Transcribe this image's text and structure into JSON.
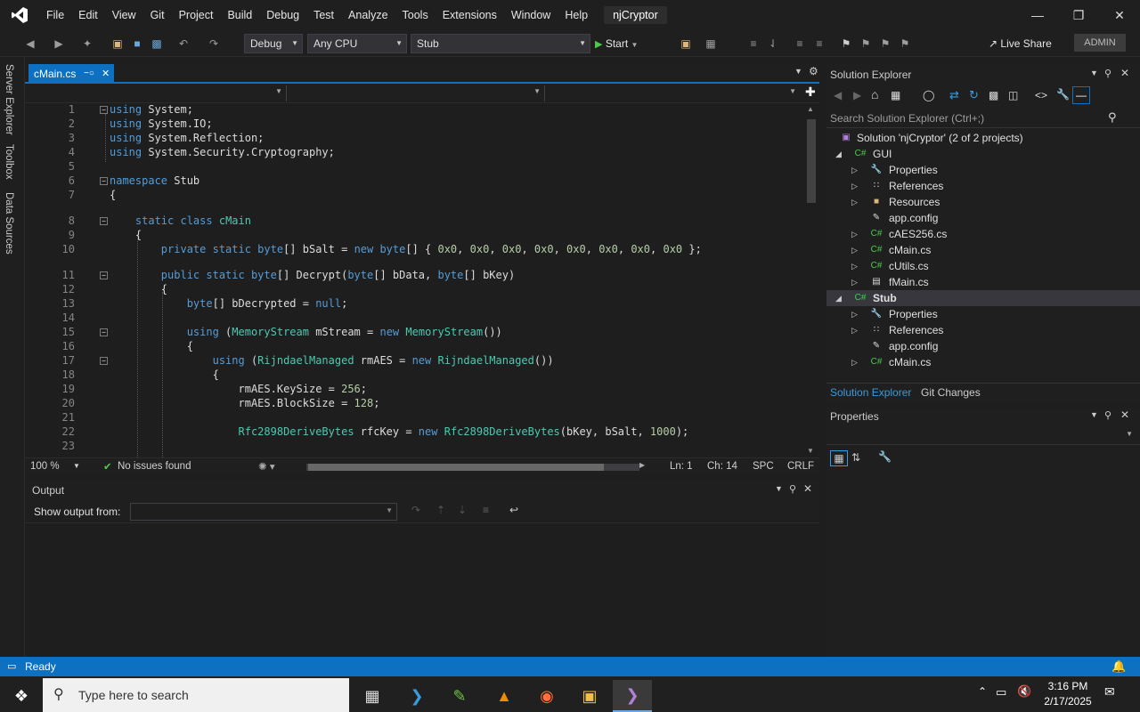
{
  "menubar": {
    "items": [
      "File",
      "Edit",
      "View",
      "Git",
      "Project",
      "Build",
      "Debug",
      "Test",
      "Analyze",
      "Tools",
      "Extensions",
      "Window",
      "Help"
    ],
    "solution_title": "njCryptor"
  },
  "toolbar": {
    "config": "Debug",
    "platform": "Any CPU",
    "startup": "Stub",
    "start_label": "Start",
    "live_share": "Live Share",
    "user": "ADMIN"
  },
  "side_tabs": [
    "Server Explorer",
    "Toolbox",
    "Data Sources"
  ],
  "editor": {
    "tab_label": "cMain.cs",
    "zoom": "100 %",
    "issues": "No issues found",
    "ln": "Ln: 1",
    "ch": "Ch: 14",
    "spc": "SPC",
    "crlf": "CRLF",
    "lines": [
      {
        "n": "1",
        "t": "using System;"
      },
      {
        "n": "2",
        "t": "using System.IO;"
      },
      {
        "n": "3",
        "t": "using System.Reflection;"
      },
      {
        "n": "4",
        "t": "using System.Security.Cryptography;"
      },
      {
        "n": "5",
        "t": ""
      },
      {
        "n": "6",
        "t": "namespace Stub"
      },
      {
        "n": "7",
        "t": "{"
      },
      {
        "n": "8",
        "t": "    static class cMain"
      },
      {
        "n": "9",
        "t": "    {"
      },
      {
        "n": "10",
        "t": "        private static byte[] bSalt = new byte[] { 0x0, 0x0, 0x0, 0x0, 0x0, 0x0, 0x0, 0x0 };"
      },
      {
        "n": "11",
        "t": "        public static byte[] Decrypt(byte[] bData, byte[] bKey)"
      },
      {
        "n": "12",
        "t": "        {"
      },
      {
        "n": "13",
        "t": "            byte[] bDecrypted = null;"
      },
      {
        "n": "14",
        "t": ""
      },
      {
        "n": "15",
        "t": "            using (MemoryStream mStream = new MemoryStream())"
      },
      {
        "n": "16",
        "t": "            {"
      },
      {
        "n": "17",
        "t": "                using (RijndaelManaged rmAES = new RijndaelManaged())"
      },
      {
        "n": "18",
        "t": "                {"
      },
      {
        "n": "19",
        "t": "                    rmAES.KeySize = 256;"
      },
      {
        "n": "20",
        "t": "                    rmAES.BlockSize = 128;"
      },
      {
        "n": "21",
        "t": ""
      },
      {
        "n": "22",
        "t": "                    Rfc2898DeriveBytes rfcKey = new Rfc2898DeriveBytes(bKey, bSalt, 1000);"
      },
      {
        "n": "23",
        "t": ""
      }
    ]
  },
  "output": {
    "title": "Output",
    "show_from": "Show output from:"
  },
  "solution_explorer": {
    "title": "Solution Explorer",
    "search_placeholder": "Search Solution Explorer (Ctrl+;)",
    "solution": "Solution 'njCryptor' (2 of 2 projects)",
    "gui": "GUI",
    "gui_items": [
      "Properties",
      "References",
      "Resources",
      "app.config",
      "cAES256.cs",
      "cMain.cs",
      "cUtils.cs",
      "fMain.cs"
    ],
    "stub": "Stub",
    "stub_items": [
      "Properties",
      "References",
      "app.config",
      "cMain.cs"
    ],
    "tab_solution": "Solution Explorer",
    "tab_git": "Git Changes"
  },
  "properties": {
    "title": "Properties"
  },
  "status": {
    "ready": "Ready"
  },
  "taskbar": {
    "search_placeholder": "Type here to search",
    "time": "3:16 PM",
    "date": "2/17/2025"
  },
  "colors": {
    "accent": "#0e70c0",
    "keyword": "#569cd6",
    "type": "#4ec9b0"
  }
}
